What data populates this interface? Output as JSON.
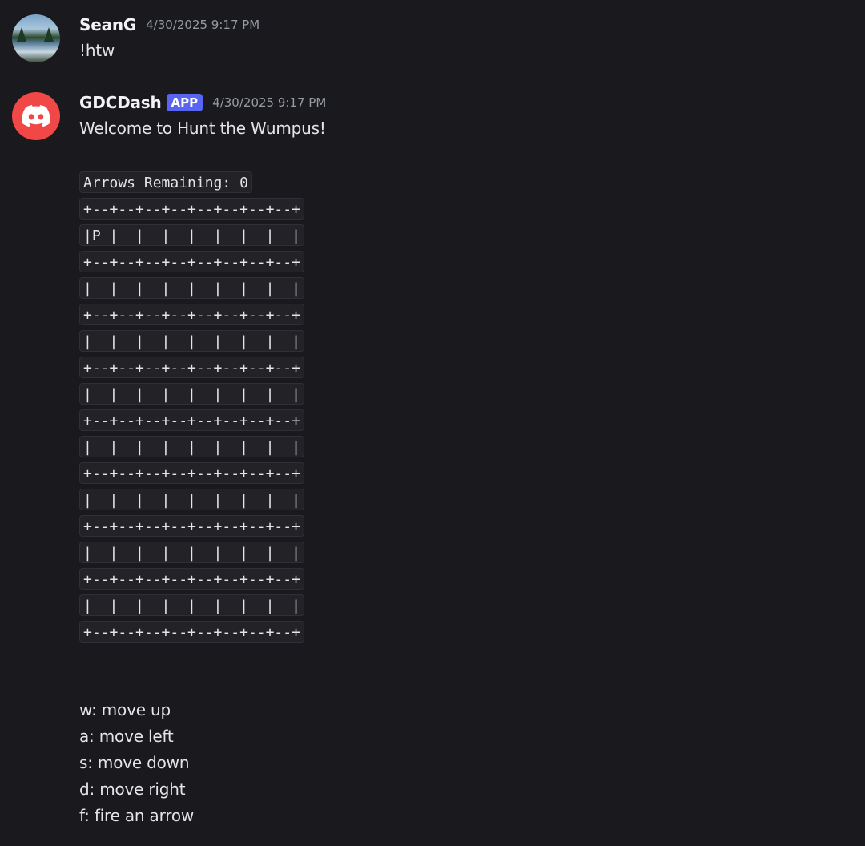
{
  "messages": [
    {
      "username": "SeanG",
      "timestamp": "4/30/2025 9:17 PM",
      "text": "!htw"
    },
    {
      "username": "GDCDash",
      "badge": "APP",
      "timestamp": "4/30/2025 9:17 PM",
      "text": "Welcome to Hunt the Wumpus!",
      "code_lines": [
        "Arrows Remaining: 0",
        "+--+--+--+--+--+--+--+--+",
        "|P |  |  |  |  |  |  |  |",
        "+--+--+--+--+--+--+--+--+",
        "|  |  |  |  |  |  |  |  |",
        "+--+--+--+--+--+--+--+--+",
        "|  |  |  |  |  |  |  |  |",
        "+--+--+--+--+--+--+--+--+",
        "|  |  |  |  |  |  |  |  |",
        "+--+--+--+--+--+--+--+--+",
        "|  |  |  |  |  |  |  |  |",
        "+--+--+--+--+--+--+--+--+",
        "|  |  |  |  |  |  |  |  |",
        "+--+--+--+--+--+--+--+--+",
        "|  |  |  |  |  |  |  |  |",
        "+--+--+--+--+--+--+--+--+",
        "|  |  |  |  |  |  |  |  |",
        "+--+--+--+--+--+--+--+--+"
      ],
      "help_lines": [
        "w: move up",
        "a: move left",
        "s: move down",
        "d: move right",
        "f: fire an arrow"
      ]
    }
  ],
  "icons": {
    "user_avatar": "landscape-avatar-icon",
    "bot_avatar": "discord-logo-icon"
  },
  "colors": {
    "background": "#1a1a1e",
    "app_badge": "#5865f2",
    "bot_avatar": "#f04747",
    "timestamp": "#949ba4"
  }
}
